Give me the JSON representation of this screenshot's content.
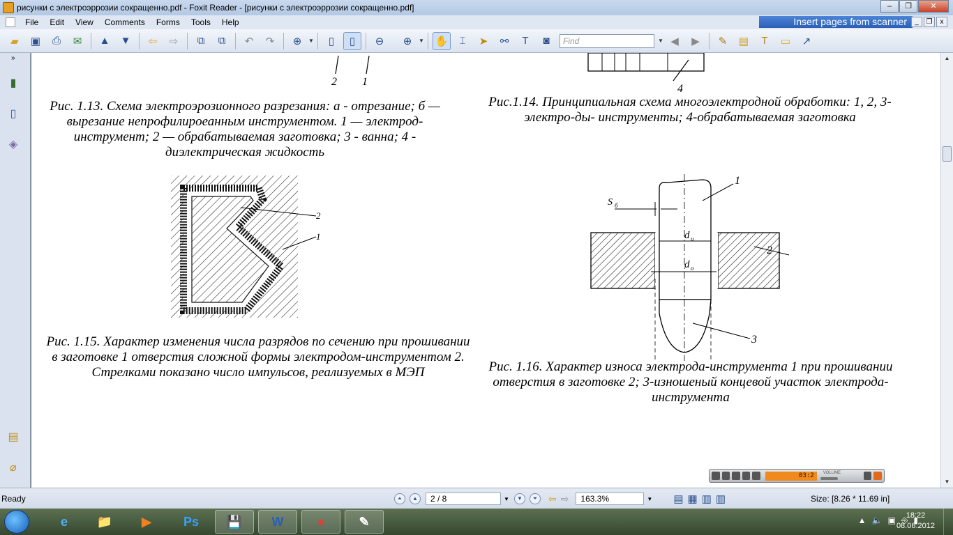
{
  "window": {
    "title": "рисунки с электроэррозии сокращенно.pdf - Foxit Reader - [рисунки с электроэррозии сокращенно.pdf]",
    "minimize": "‒",
    "maximize": "❐",
    "close": "✕"
  },
  "menu": {
    "items": [
      "File",
      "Edit",
      "View",
      "Comments",
      "Forms",
      "Tools",
      "Help"
    ],
    "banner": "Insert pages from scanner"
  },
  "toolbar": {
    "find_placeholder": "Find"
  },
  "document": {
    "fig113_labels": [
      "2",
      "1"
    ],
    "fig113_caption": "Рис. 1.13. Схема электроэрозионного разрезания: а - отрезание; б — вырезание непрофилироеанным инструментом. 1 — электрод-инструмент; 2 — обрабатываемая заготовка; 3 - ванна; 4 - диэлектрическая жидкость",
    "fig114_label": "4",
    "fig114_caption": "Рис.1.14. Принципиальная схема многоэлектродной обработки:   1, 2, 3-электро-ды- инструменты; 4-обрабатываемая заготовка",
    "fig115_labels": [
      "2",
      "1"
    ],
    "fig115_caption": "Рис. 1.15. Характер изменения числа разрядов по сечению при прошивании в заготовке 1 отверстия сложной формы электродом-инструментом 2. Стрелками показано число импульсов, реализуемых в МЭП",
    "fig116_labels": {
      "s": "S",
      "s_sub": "б",
      "du": "d",
      "du_sub": "и",
      "do": "d",
      "do_sub": "о",
      "n1": "1",
      "n2": "2",
      "n3": "3"
    },
    "fig116_caption": "Рис. 1.16. Характер износа электрода-инструмента 1 при прошивании отверстия в заготовке 2; 3-изношеный концевой участок электрода-инструмента"
  },
  "player": {
    "time": "03:2",
    "volume_label": "VOLUME",
    "volume_level": 0.45
  },
  "status": {
    "ready": "Ready",
    "page": "2 / 8",
    "zoom": "163.3%",
    "size": "Size: [8.26 * 11.69 in]"
  },
  "taskbar": {
    "apps": [
      "e",
      "📁",
      "▶",
      "Ps",
      "💾",
      "W",
      "●",
      "✎"
    ],
    "time": "18:22",
    "date": "08.06.2012"
  }
}
